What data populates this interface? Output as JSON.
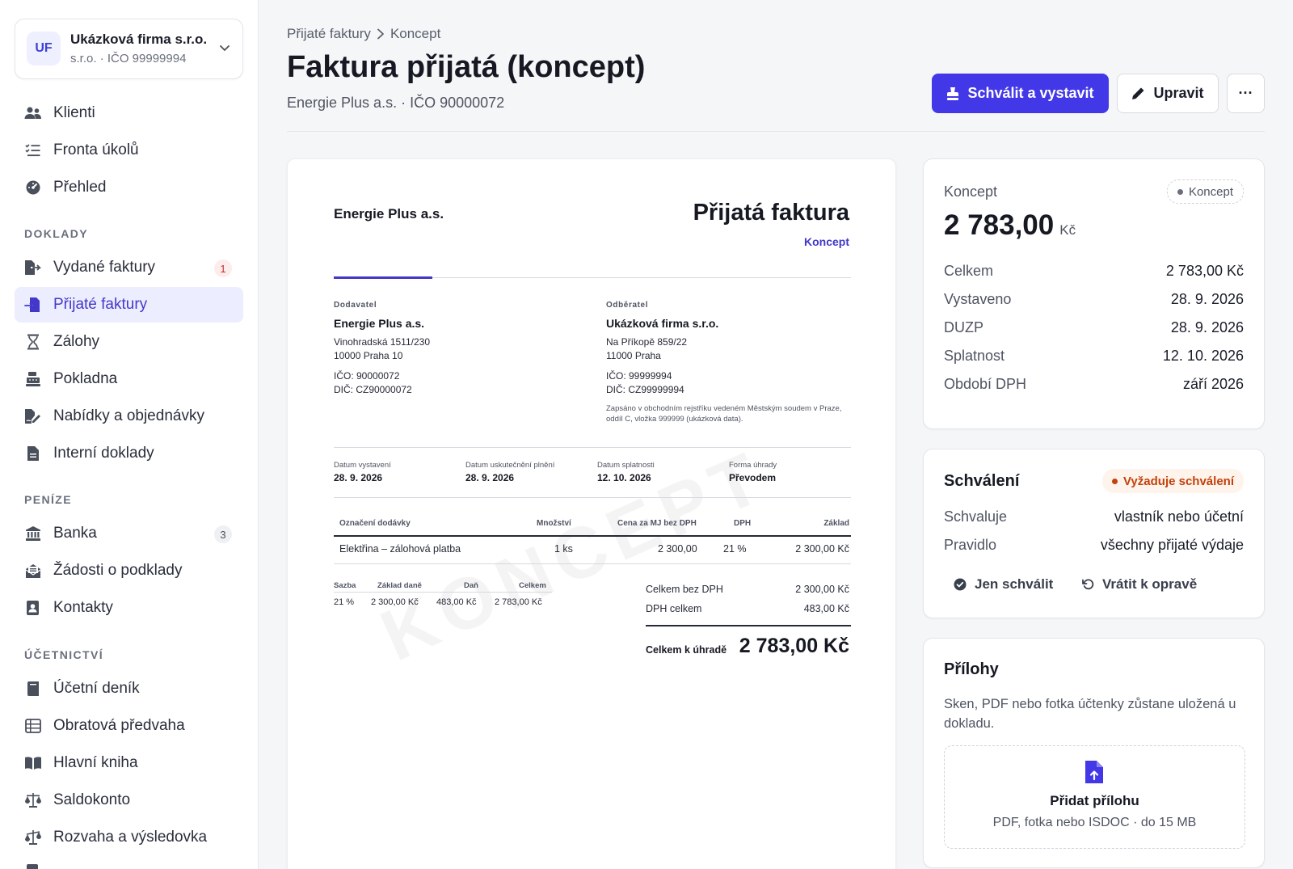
{
  "colors": {
    "accent": "#4338e8",
    "accent_text": "#4338ca",
    "warning": "#c2410c",
    "badge_red": "#c0322b"
  },
  "company": {
    "initials": "UF",
    "name": "Ukázková firma s.r.o.",
    "subtitle": "s.r.o. · IČO 99999994"
  },
  "sidebar": {
    "top_items": [
      {
        "label": "Klienti",
        "icon": "users-icon"
      },
      {
        "label": "Fronta úkolů",
        "icon": "task-list-icon"
      },
      {
        "label": "Přehled",
        "icon": "dashboard-gauge-icon"
      }
    ],
    "sections": {
      "doklady": "DOKLADY",
      "penize": "PENÍZE",
      "ucetnictvi": "ÚČETNICTVÍ"
    },
    "doklady_items": [
      {
        "label": "Vydané faktury",
        "icon": "file-export-icon",
        "badge": "1"
      },
      {
        "label": "Přijaté faktury",
        "icon": "file-import-icon",
        "active": true
      },
      {
        "label": "Zálohy",
        "icon": "hourglass-icon"
      },
      {
        "label": "Pokladna",
        "icon": "cash-register-icon"
      },
      {
        "label": "Nabídky a objednávky",
        "icon": "file-signature-icon"
      },
      {
        "label": "Interní doklady",
        "icon": "file-icon"
      }
    ],
    "penize_items": [
      {
        "label": "Banka",
        "icon": "bank-icon",
        "badge": "3"
      },
      {
        "label": "Žádosti o podklady",
        "icon": "envelope-open-icon"
      },
      {
        "label": "Kontakty",
        "icon": "contact-book-icon"
      }
    ],
    "ucetnictvi_items": [
      {
        "label": "Účetní deník",
        "icon": "book-icon"
      },
      {
        "label": "Obratová předvaha",
        "icon": "table-list-icon"
      },
      {
        "label": "Hlavní kniha",
        "icon": "book-open-icon"
      },
      {
        "label": "Saldokonto",
        "icon": "scale-balanced-icon"
      },
      {
        "label": "Rozvaha a výsledovka",
        "icon": "scale-unbalanced-icon"
      }
    ]
  },
  "header": {
    "breadcrumb": [
      "Přijaté faktury",
      "Koncept"
    ],
    "title": "Faktura přijatá (koncept)",
    "subtitle": "Energie Plus a.s. · IČO 90000072",
    "approve_button": "Schválit a vystavit",
    "edit_button": "Upravit",
    "more_button": "···"
  },
  "invoice": {
    "seller_heading": "Energie Plus a.s.",
    "doc_title": "Přijatá faktura",
    "doc_status": "Koncept",
    "watermark": "KONCEPT",
    "supplier": {
      "label": "Dodavatel",
      "name": "Energie Plus a.s.",
      "street": "Vinohradská 1511/230",
      "city": "10000 Praha 10",
      "ico": "IČO: 90000072",
      "dic": "DIČ: CZ90000072"
    },
    "customer": {
      "label": "Odběratel",
      "name": "Ukázková firma s.r.o.",
      "street": "Na Příkopě 859/22",
      "city": "11000 Praha",
      "ico": "IČO: 99999994",
      "dic": "DIČ: CZ99999994",
      "registry_note": "Zapsáno v obchodním rejstříku vedeném Městským soudem v Praze, oddíl C, vložka 999999 (ukázková data)."
    },
    "meta": [
      {
        "label": "Datum vystavení",
        "value": "28. 9. 2026"
      },
      {
        "label": "Datum uskutečnění plnění",
        "value": "28. 9. 2026"
      },
      {
        "label": "Datum splatnosti",
        "value": "12. 10. 2026"
      },
      {
        "label": "Forma úhrady",
        "value": "Převodem"
      }
    ],
    "items_header": [
      "Označení dodávky",
      "Množství",
      "Cena za MJ bez DPH",
      "DPH",
      "Základ"
    ],
    "items": [
      {
        "name": "Elektřina – zálohová platba",
        "qty": "1 ks",
        "unit_price": "2 300,00",
        "vat": "21 %",
        "base": "2 300,00 Kč"
      }
    ],
    "vat_header": [
      "Sazba",
      "Základ daně",
      "Daň",
      "Celkem"
    ],
    "vat_rows": [
      {
        "rate": "21 %",
        "base": "2 300,00 Kč",
        "tax": "483,00 Kč",
        "total": "2 783,00 Kč"
      }
    ],
    "totals": {
      "net_label": "Celkem bez DPH",
      "net_value": "2 300,00 Kč",
      "vat_label": "DPH celkem",
      "vat_value": "483,00 Kč",
      "due_label": "Celkem k úhradě",
      "due_value": "2 783,00 Kč"
    }
  },
  "summary": {
    "title": "Koncept",
    "status_pill": "Koncept",
    "amount": "2 783,00",
    "currency": "Kč",
    "rows": [
      {
        "label": "Celkem",
        "value": "2 783,00 Kč"
      },
      {
        "label": "Vystaveno",
        "value": "28. 9. 2026"
      },
      {
        "label": "DUZP",
        "value": "28. 9. 2026"
      },
      {
        "label": "Splatnost",
        "value": "12. 10. 2026"
      },
      {
        "label": "Období DPH",
        "value": "září 2026"
      }
    ]
  },
  "approval": {
    "title": "Schválení",
    "status_pill": "Vyžaduje schválení",
    "rows": [
      {
        "label": "Schvaluje",
        "value": "vlastník nebo účetní"
      },
      {
        "label": "Pravidlo",
        "value": "všechny přijaté výdaje"
      }
    ],
    "approve_only": "Jen schválit",
    "return_for_fix": "Vrátit k opravě"
  },
  "attachments": {
    "title": "Přílohy",
    "description": "Sken, PDF nebo fotka účtenky zůstane uložená u dokladu.",
    "add_label": "Přidat přílohu",
    "hint": "PDF, fotka nebo ISDOC · do 15 MB"
  }
}
